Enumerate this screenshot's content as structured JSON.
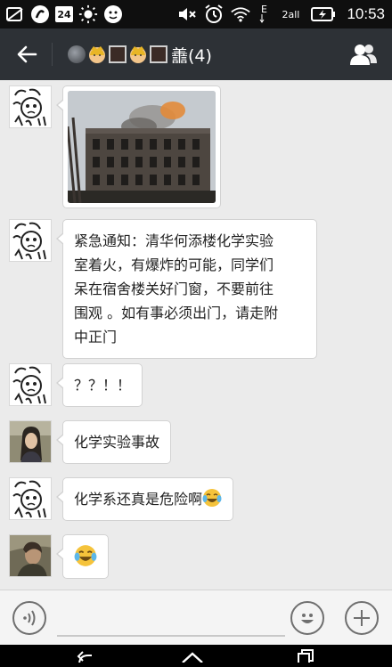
{
  "status_bar": {
    "calendar_day": "24",
    "network_type": "E",
    "signal_label": "2all",
    "time": "10:53",
    "icons": [
      "no-sim-icon",
      "app-notification-icon",
      "calendar-icon",
      "sun-icon",
      "face-notification-icon",
      "mute-icon",
      "alarm-icon",
      "wifi-icon",
      "data-arrows-icon",
      "signal-icon",
      "battery-charging-icon"
    ]
  },
  "title_bar": {
    "title_suffix": "譱(4)",
    "back_icon": "arrow-left-icon",
    "members_icon": "people-icon"
  },
  "messages": [
    {
      "sender": "doodle-face",
      "type": "image",
      "image_desc_icon": "fire-building-photo"
    },
    {
      "sender": "doodle-face",
      "type": "text",
      "lines": [
        "紧急通知：清华何添楼化学实验",
        "室着火，有爆炸的可能，同学们",
        "呆在宿舍楼关好门窗，不要前往",
        "围观 。如有事必须出门，请走附",
        "中正门"
      ]
    },
    {
      "sender": "doodle-face",
      "type": "text",
      "text": "？？！！"
    },
    {
      "sender": "person-1",
      "type": "text",
      "text": "化学实验事故"
    },
    {
      "sender": "doodle-face",
      "type": "text",
      "text": "化学系还真是危险啊",
      "emoji": "tears-of-joy-emoji"
    },
    {
      "sender": "person-2",
      "type": "emoji",
      "emoji": "tears-of-joy-emoji"
    }
  ],
  "input_bar": {
    "value": "",
    "voice_icon": "voice-icon",
    "emoji_icon": "smiley-icon",
    "more_icon": "plus-icon"
  },
  "nav_bar": {
    "icons": [
      "back-nav-icon",
      "home-nav-icon",
      "recents-nav-icon"
    ]
  },
  "colors": {
    "title_bar_bg": "#2d3136",
    "status_bar_bg": "#0f0f0f",
    "chat_bg": "#ebebeb",
    "bubble_bg": "#ffffff"
  }
}
